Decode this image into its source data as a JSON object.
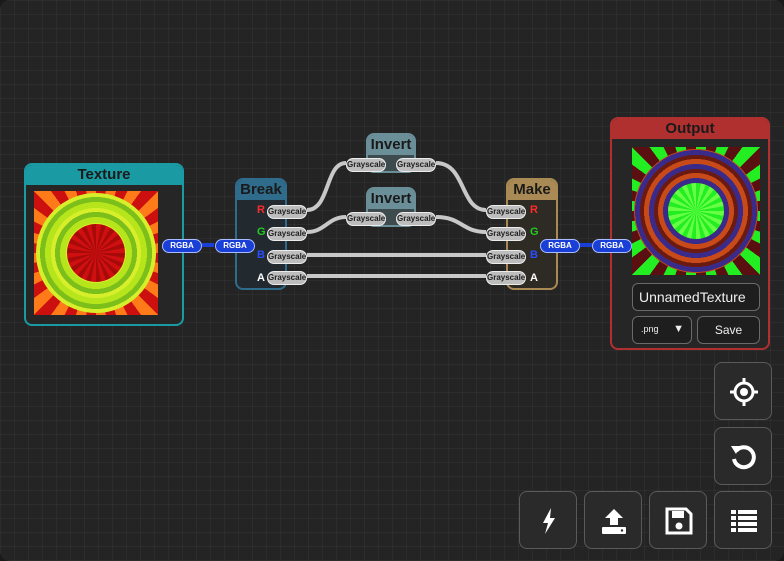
{
  "nodes": {
    "texture": {
      "title": "Texture",
      "port_label": "RGBA"
    },
    "break": {
      "title": "Break",
      "input_label": "RGBA",
      "channels": [
        "R",
        "G",
        "B",
        "A"
      ],
      "output_label": "Grayscale"
    },
    "invert_top": {
      "title": "Invert",
      "in_label": "Grayscale",
      "out_label": "Grayscale"
    },
    "invert_bottom": {
      "title": "Invert",
      "in_label": "Grayscale",
      "out_label": "Grayscale"
    },
    "make": {
      "title": "Make",
      "input_label": "Grayscale",
      "channels": [
        "R",
        "G",
        "B",
        "A"
      ],
      "output_label": "RGBA"
    },
    "output": {
      "title": "Output",
      "input_label": "RGBA",
      "filename": "UnnamedTexture",
      "format": ".png",
      "save_label": "Save"
    }
  },
  "toolbar": {
    "center_icon": "crosshair-icon",
    "reset_icon": "refresh-icon",
    "run_icon": "lightning-icon",
    "upload_icon": "upload-icon",
    "save_icon": "floppy-disk-icon",
    "list_icon": "list-icon"
  },
  "colors": {
    "background": "#242424",
    "texture_node": "#1a9aa3",
    "break_node": "#2f6b8a",
    "invert_node": "#6a8f99",
    "make_node": "#a98a55",
    "output_node": "#b03030",
    "channel_r": "#ff2a2a",
    "channel_g": "#22cc22",
    "channel_b": "#2a4dff",
    "channel_a": "#ffffff"
  }
}
